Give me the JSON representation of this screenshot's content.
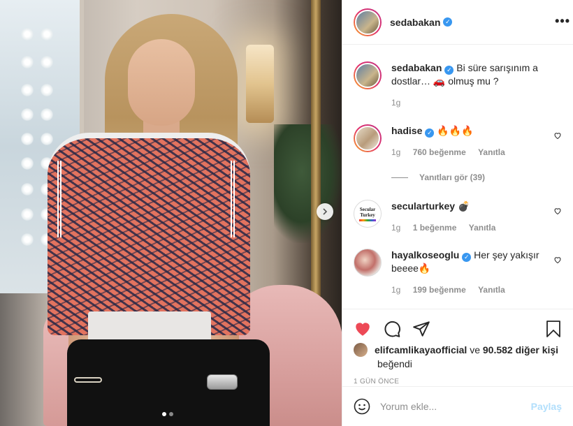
{
  "post": {
    "author": "sedabakan",
    "author_verified": true,
    "caption": "Bi süre sarışınım a dostlar… 🚗 olmuş mu ?",
    "caption_time": "1g",
    "image_pages": 2,
    "image_current_page": 1
  },
  "header": {
    "username": "sedabakan",
    "more_label": "•••"
  },
  "comments": [
    {
      "username": "hadise",
      "verified": true,
      "text": "🔥🔥🔥",
      "time": "1g",
      "likes": "760 beğenme",
      "reply": "Yanıtla",
      "view_replies": "Yanıtları gör (39)"
    },
    {
      "username": "secularturkey",
      "verified": false,
      "text": "💣",
      "time": "1g",
      "likes": "1 beğenme",
      "reply": "Yanıtla",
      "avatar_text_1": "Secular",
      "avatar_text_2": "Turkey"
    },
    {
      "username": "hayalkoseoglu",
      "verified": true,
      "text": "Her şey yakışır beeee🔥",
      "time": "1g",
      "likes": "199 beğenme",
      "reply": "Yanıtla"
    }
  ],
  "likes": {
    "first_liker": "elifcamlikayaofficial",
    "connector": "ve",
    "others": "90.582 diğer kişi",
    "suffix": "beğendi"
  },
  "timestamp": "1 GÜN ÖNCE",
  "comment_box": {
    "placeholder": "Yorum ekle...",
    "post_label": "Paylaş"
  },
  "colors": {
    "like_red": "#ed4956",
    "verified_blue": "#3897f0",
    "muted_text": "#8e8e8e",
    "post_button_disabled": "#b2dffc"
  },
  "icons": [
    "heart-filled-icon",
    "comment-icon",
    "share-icon",
    "bookmark-icon",
    "emoji-icon",
    "more-icon",
    "chevron-right-icon",
    "verified-icon"
  ]
}
